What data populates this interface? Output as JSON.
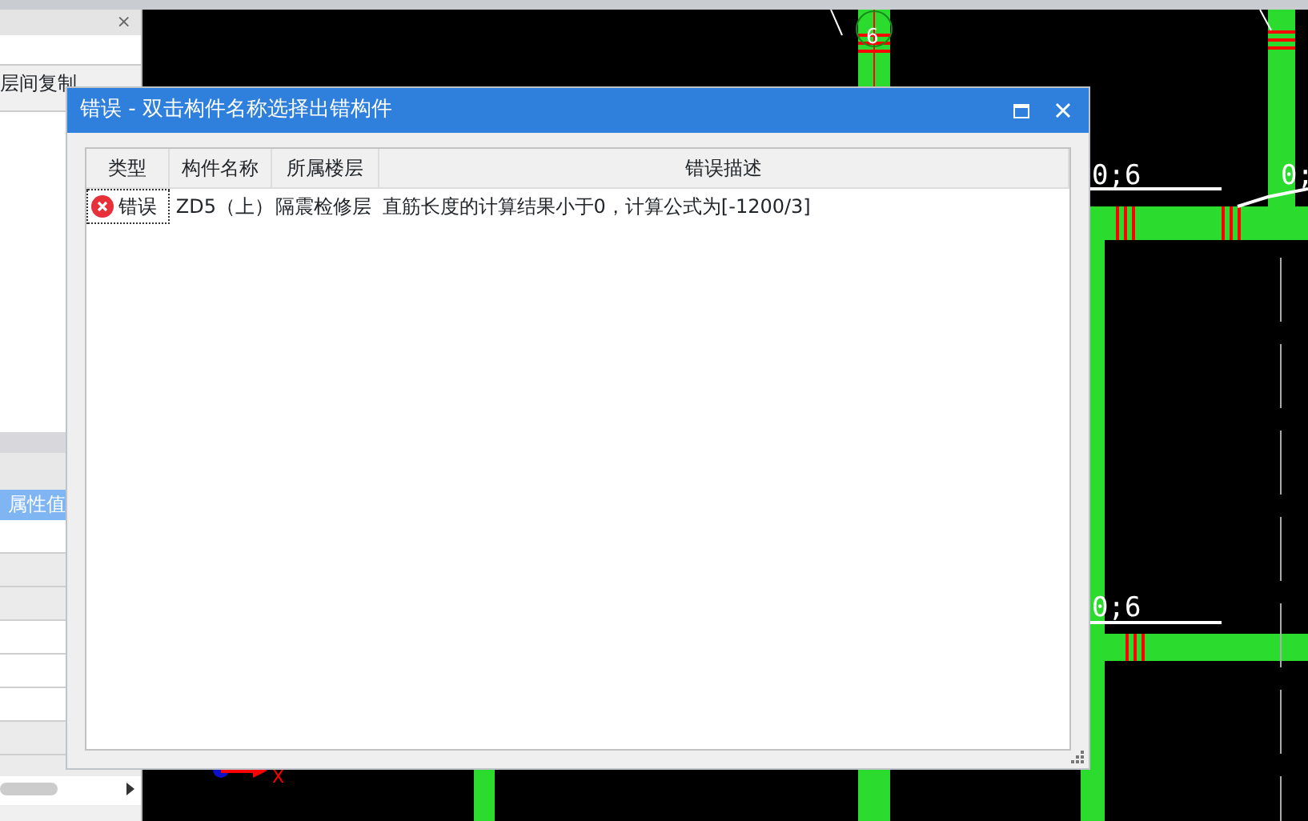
{
  "left_panel": {
    "close": "×",
    "toolbar_label": "层间复制",
    "property_header": "属性值"
  },
  "dialog": {
    "title": "错误 - 双击构件名称选择出错构件",
    "columns": [
      "类型",
      "构件名称",
      "所属楼层",
      "错误描述"
    ],
    "rows": [
      {
        "kind": "error",
        "type": "错误",
        "name": "ZD5（上）",
        "floor": "隔震检修层",
        "description": "直筋长度的计算结果小于0，计算公式为[-1200/3]",
        "selected": true
      }
    ]
  },
  "canvas": {
    "dimension_labels": [
      "6",
      "0;6",
      "0;",
      "0;6"
    ],
    "axis_label": "X"
  }
}
